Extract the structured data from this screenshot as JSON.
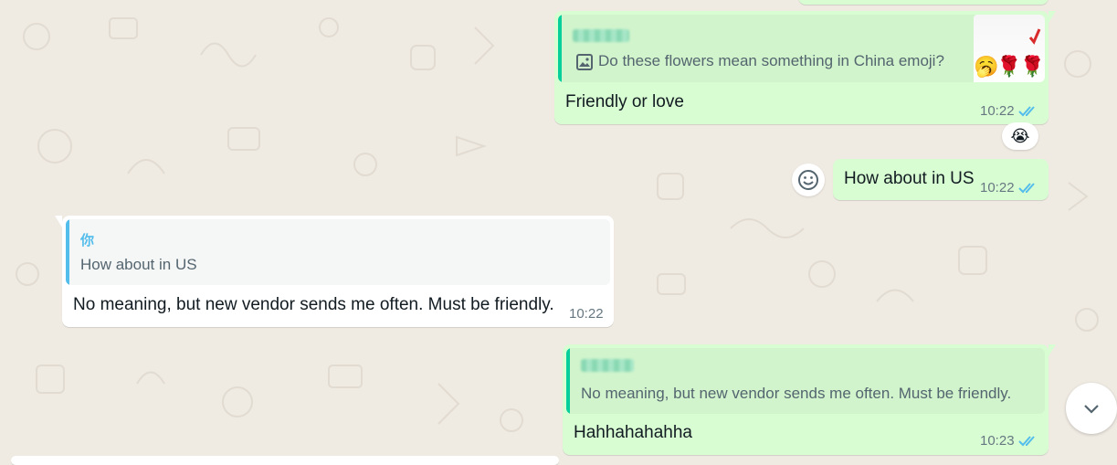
{
  "colors": {
    "wallpaper": "#efeae2",
    "outgoing_bubble": "#d9fdd3",
    "incoming_bubble": "#ffffff",
    "read_ticks": "#53bdeb",
    "quote_bar_contact": "#06cf9c",
    "quote_bar_self": "#53bdeb"
  },
  "messages": [
    {
      "direction": "out",
      "quote": {
        "author": "",
        "text": "Do these flowers mean something in China emoji?",
        "icon": "image-icon",
        "thumbnail_emojis": "🥱🌹🌹"
      },
      "text": "Friendly or love",
      "time": "10:22",
      "status": "read",
      "reaction": "😭"
    },
    {
      "direction": "out",
      "text": "How about in US",
      "time": "10:22",
      "status": "read"
    },
    {
      "direction": "in",
      "quote": {
        "author": "你",
        "text": "How about in US"
      },
      "text": "No meaning, but new vendor sends me often. Must be friendly.",
      "time": "10:22"
    },
    {
      "direction": "out",
      "quote": {
        "author": "",
        "text": "No meaning, but new vendor sends me often. Must be friendly."
      },
      "text": "Hahhahahahha",
      "time": "10:23",
      "status": "read"
    }
  ]
}
